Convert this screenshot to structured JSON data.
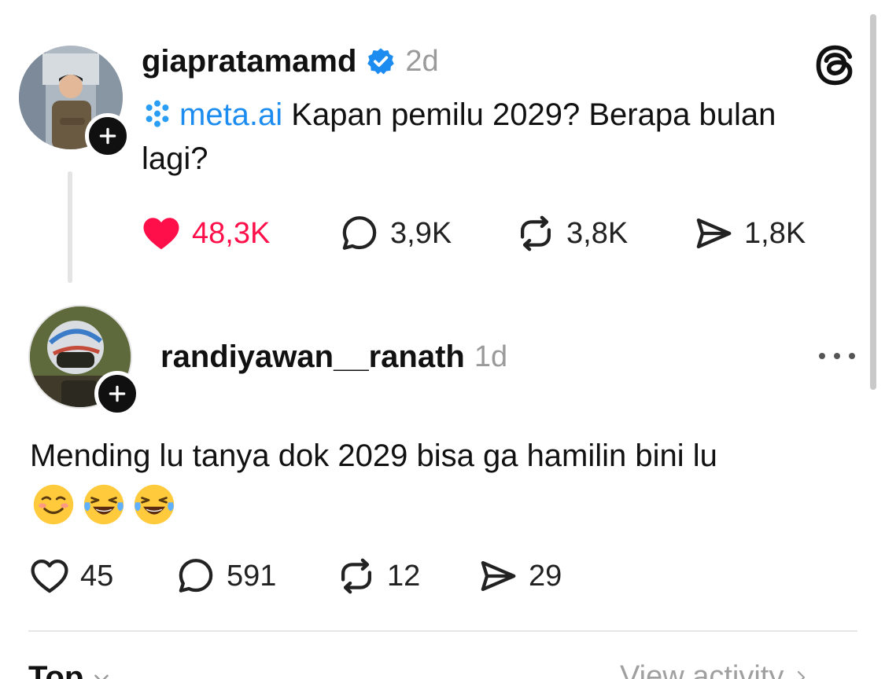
{
  "post": {
    "username": "giapratamamd",
    "time": "2d",
    "mention": "meta.ai",
    "text": " Kapan pemilu 2029? Berapa bulan lagi?",
    "likes": "48,3K",
    "replies": "3,9K",
    "reposts": "3,8K",
    "shares": "1,8K"
  },
  "reply": {
    "username": "randiyawan__ranath",
    "time": "1d",
    "text": "Mending lu tanya dok 2029 bisa ga hamilin bini lu",
    "emojis": [
      "smiling-face-icon",
      "tears-of-joy-icon",
      "tears-of-joy-icon"
    ],
    "likes": "45",
    "replies": "591",
    "reposts": "12",
    "shares": "29"
  },
  "footer": {
    "sort_label": "Top",
    "view_activity": "View activity"
  },
  "colors": {
    "like_red": "#ff0f4a",
    "mention_blue": "#1d8cf0",
    "verified_blue": "#1d8cf0",
    "secondary_gray": "#9a9a9a"
  }
}
